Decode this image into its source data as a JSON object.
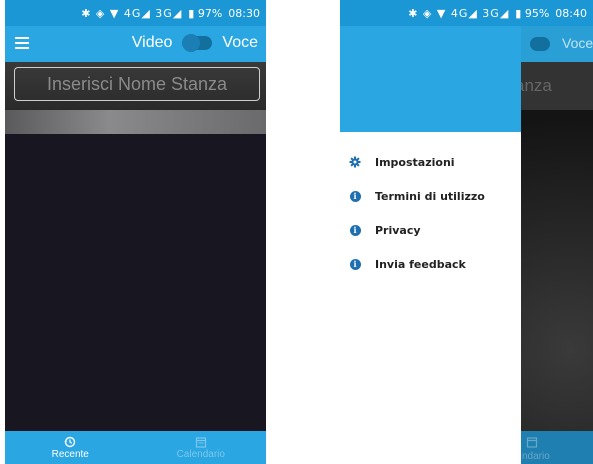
{
  "screen1": {
    "status": {
      "icons": "✱ ◈ ▼ 4G◢ 3G◢",
      "battery": "▮ 97%",
      "time": "08:30"
    },
    "appbar": {
      "video_label": "Video",
      "voce_label": "Voce"
    },
    "room_input": {
      "placeholder": "Inserisci Nome Stanza"
    },
    "bottom_nav": [
      {
        "label": "Recente",
        "icon": "history-icon",
        "active": true
      },
      {
        "label": "Calendario",
        "icon": "calendar-icon",
        "active": false
      }
    ]
  },
  "screen2": {
    "status": {
      "icons": "✱ ◈ ▼ 4G◢ 3G◢",
      "battery": "▮ 95%",
      "time": "08:40"
    },
    "background": {
      "voce_label": "Voce",
      "stanza_fragment": "anza",
      "nav_fragment": "ndario"
    },
    "drawer": {
      "items": [
        {
          "label": "Impostazioni",
          "icon": "gear-icon"
        },
        {
          "label": "Termini di utilizzo",
          "icon": "info-icon"
        },
        {
          "label": "Privacy",
          "icon": "info-icon"
        },
        {
          "label": "Invia feedback",
          "icon": "info-icon"
        }
      ]
    }
  },
  "colors": {
    "primary": "#2aa6e2",
    "statusbar": "#1a97d4",
    "dark_bg": "#181620",
    "icon_blue": "#1e6fb0"
  }
}
